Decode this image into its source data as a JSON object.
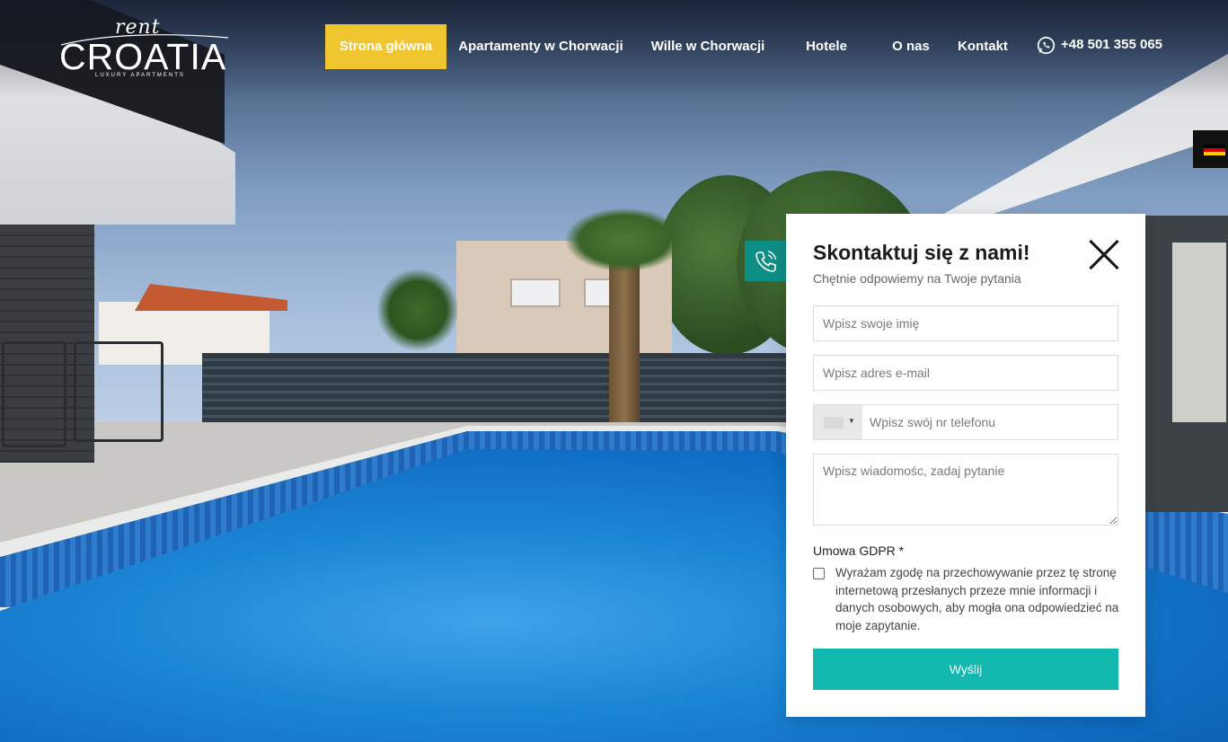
{
  "logo": {
    "script": "rent",
    "name": "CROATIA",
    "tagline": "LUXURY APARTMENTS"
  },
  "nav": {
    "items": [
      {
        "label": "Strona główna",
        "active": true
      },
      {
        "label": "Apartamenty w Chorwacji",
        "active": false
      },
      {
        "label": "Wille w Chorwacji",
        "active": false
      },
      {
        "label": "Hotele",
        "active": false
      },
      {
        "label": "O nas",
        "active": false
      },
      {
        "label": "Kontakt",
        "active": false
      }
    ],
    "phone": "+48 501 355 065",
    "phone_icon": "whatsapp-icon",
    "accent_color": "#efc630"
  },
  "language": {
    "flag": "de-flag-icon"
  },
  "contact_form": {
    "title": "Skontaktuj się z nami!",
    "subtitle": "Chętnie odpowiemy na Twoje pytania",
    "name_placeholder": "Wpisz swoje imię",
    "email_placeholder": "Wpisz adres e-mail",
    "phone_placeholder": "Wpisz swój nr telefonu",
    "message_placeholder": "Wpisz wiadomośc, zadaj pytanie",
    "gdpr_label": "Umowa GDPR *",
    "gdpr_text": "Wyrażam zgodę na przechowywanie przez tę stronę internetową przesłanych przeze mnie informacji i danych osobowych, aby mogła ona odpowiedzieć na moje zapytanie.",
    "submit_label": "Wyślij",
    "submit_color": "#13b8af",
    "tab_color": "#0d8f86"
  }
}
